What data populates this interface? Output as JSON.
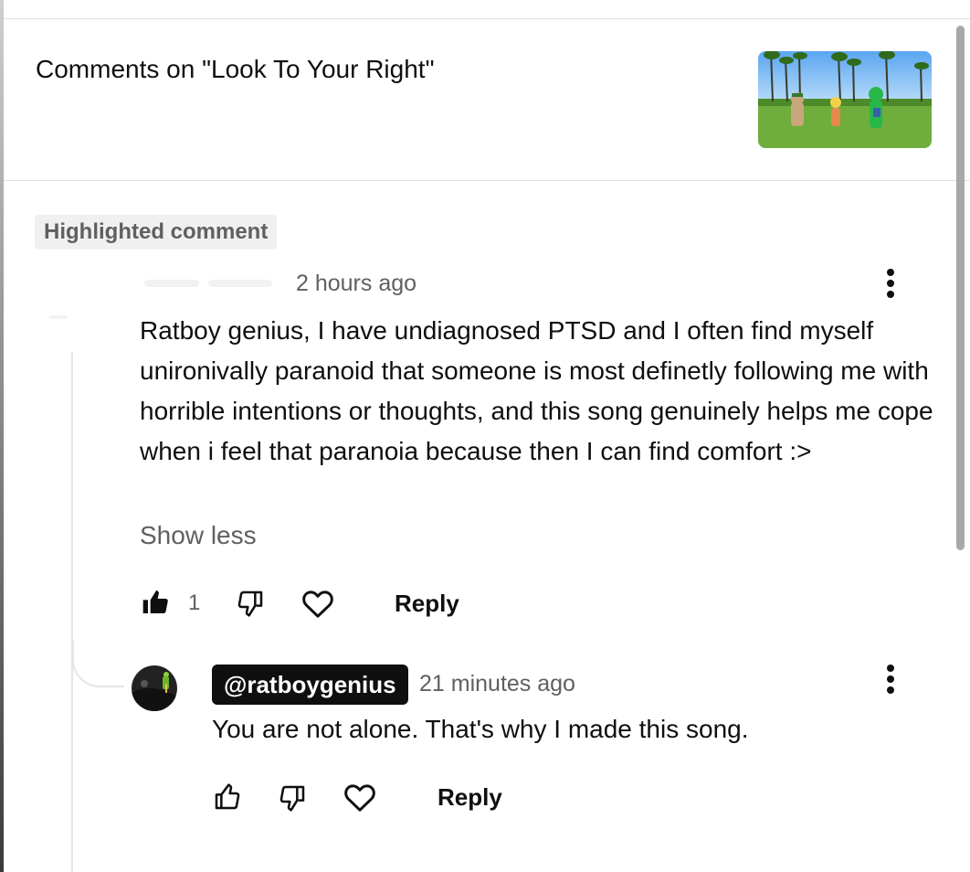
{
  "header": {
    "title": "Comments on \"Look To Your Right\"",
    "thumbnail_icon": "video-thumbnail"
  },
  "highlighted": {
    "badge": "Highlighted comment",
    "timestamp": "2 hours ago",
    "text": "Ratboy genius, I have undiagnosed PTSD and I often find myself unironivally paranoid that someone is most definetly following me with horrible intentions or thoughts, and this song genuinely helps me cope when i feel that paranoia because then I can find comfort :>",
    "show_less": "Show less",
    "like_count": "1",
    "reply_label": "Reply",
    "liked": true
  },
  "reply": {
    "handle": "@ratboygenius",
    "timestamp": "21 minutes ago",
    "text": "You are not alone. That's why I made this song.",
    "reply_label": "Reply"
  },
  "colors": {
    "text": "#0f0f0f",
    "secondary": "#606060",
    "badge_bg": "#f0f0f0"
  }
}
